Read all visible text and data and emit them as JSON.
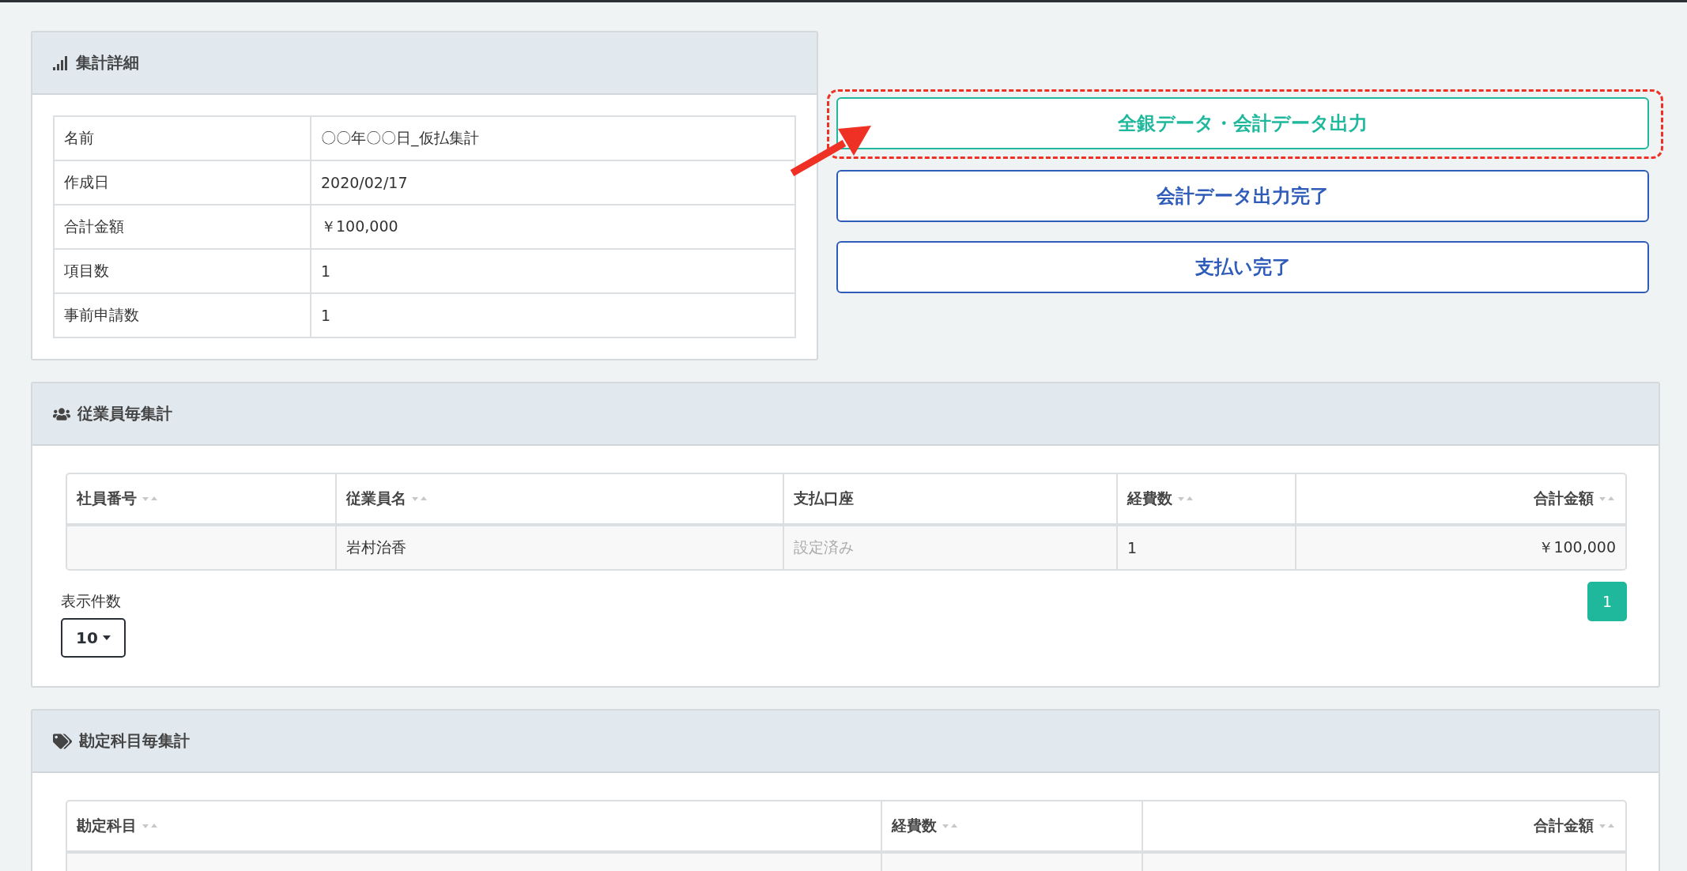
{
  "summary_panel": {
    "title": "集計詳細",
    "rows": [
      {
        "label": "名前",
        "value": "〇〇年〇〇日_仮払集計"
      },
      {
        "label": "作成日",
        "value": "2020/02/17"
      },
      {
        "label": "合計金額",
        "value": "￥100,000"
      },
      {
        "label": "項目数",
        "value": "1"
      },
      {
        "label": "事前申請数",
        "value": "1"
      }
    ]
  },
  "actions": [
    {
      "label": "全銀データ・会計データ出力",
      "kind": "highlighted"
    },
    {
      "label": "会計データ出力完了",
      "kind": "plain"
    },
    {
      "label": "支払い完了",
      "kind": "plain"
    }
  ],
  "employee_panel": {
    "title": "従業員毎集計",
    "columns": [
      {
        "label": "社員番号",
        "sortable": true
      },
      {
        "label": "従業員名",
        "sortable": true
      },
      {
        "label": "支払口座",
        "sortable": false
      },
      {
        "label": "経費数",
        "sortable": true
      },
      {
        "label": "合計金額",
        "sortable": true
      }
    ],
    "rows": [
      {
        "cells": [
          {},
          {
            "text": "岩村治香",
            "muted": false
          },
          {
            "text": "設定済み",
            "muted": true
          },
          {
            "text": "1",
            "muted": false
          },
          {
            "text": "￥100,000",
            "muted": false
          }
        ]
      }
    ],
    "page_size_label": "表示件数",
    "page_size": "10",
    "pages": [
      {
        "label": "1",
        "selected": true
      }
    ]
  },
  "account_panel": {
    "title": "勘定科目毎集計",
    "columns": [
      {
        "label": "勘定科目",
        "sortable": true
      },
      {
        "label": "経費数",
        "sortable": true
      },
      {
        "label": "合計金額",
        "sortable": true
      }
    ]
  }
}
